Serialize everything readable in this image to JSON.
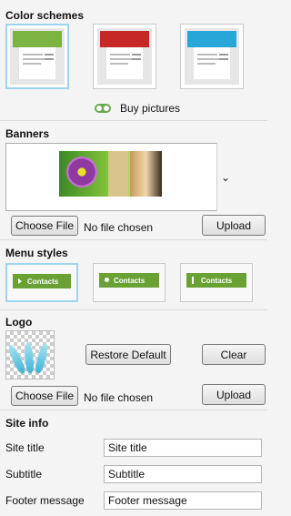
{
  "color_schemes": {
    "title": "Color schemes",
    "options": [
      {
        "accent": "#7cb342",
        "header": "#4f8a2b"
      },
      {
        "accent": "#c62828",
        "header": "#8e1b1b"
      },
      {
        "accent": "#29a6d8",
        "header": "#1c6f9a"
      }
    ],
    "selected_index": 0,
    "buy_label": "Buy pictures"
  },
  "banners": {
    "title": "Banners",
    "choose_file_label": "Choose File",
    "no_file_label": "No file chosen",
    "upload_label": "Upload",
    "dropdown_icon": "chevron-down-icon"
  },
  "menu_styles": {
    "title": "Menu styles",
    "options": [
      {
        "label": "Contacts",
        "marker": "arrow"
      },
      {
        "label": "Contacts",
        "marker": "round"
      },
      {
        "label": "Contacts",
        "marker": "bar"
      }
    ],
    "selected_index": 0,
    "bar_color": "#6aa135"
  },
  "logo": {
    "title": "Logo",
    "restore_label": "Restore Default",
    "clear_label": "Clear",
    "choose_file_label": "Choose File",
    "no_file_label": "No file chosen",
    "upload_label": "Upload"
  },
  "site_info": {
    "title": "Site info",
    "site_title_label": "Site title",
    "site_title_value": "Site title",
    "subtitle_label": "Subtitle",
    "subtitle_value": "Subtitle",
    "footer_label": "Footer message",
    "footer_value": "Footer message"
  }
}
